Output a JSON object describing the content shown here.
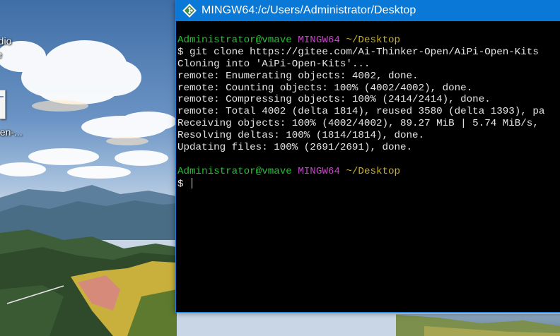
{
  "desktop": {
    "icons": [
      {
        "label_line1": "tudio",
        "label_line2": "e"
      },
      {
        "label": "pen-..."
      }
    ]
  },
  "window": {
    "title": "MINGW64:/c/Users/Administrator/Desktop",
    "colors": {
      "titlebar": "#0a78d7",
      "background": "#000000"
    }
  },
  "terminal": {
    "prompt1": {
      "user": "Administrator@vmave",
      "system": "MINGW64",
      "path": "~/Desktop"
    },
    "command": "$ git clone https://gitee.com/Ai-Thinker-Open/AiPi-Open-Kits",
    "output": [
      "Cloning into 'AiPi-Open-Kits'...",
      "remote: Enumerating objects: 4002, done.",
      "remote: Counting objects: 100% (4002/4002), done.",
      "remote: Compressing objects: 100% (2414/2414), done.",
      "remote: Total 4002 (delta 1814), reused 3580 (delta 1393), pa",
      "Receiving objects: 100% (4002/4002), 89.27 MiB | 5.74 MiB/s,",
      "Resolving deltas: 100% (1814/1814), done.",
      "Updating files: 100% (2691/2691), done."
    ],
    "prompt2": {
      "user": "Administrator@vmave",
      "system": "MINGW64",
      "path": "~/Desktop"
    },
    "input_prefix": "$ ",
    "colors": {
      "user": "#20c431",
      "system": "#c446c4",
      "path": "#c9b227",
      "text": "#e6e6e6"
    }
  }
}
